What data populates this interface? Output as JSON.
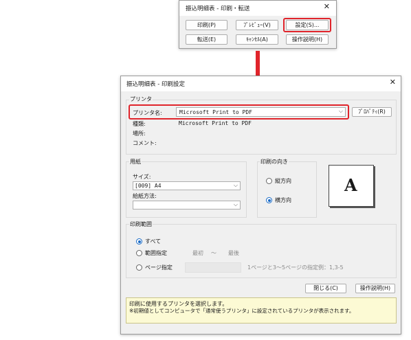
{
  "top_dialog": {
    "title": "振込明細表 - 印刷・転送",
    "buttons": {
      "print": "印刷(P)",
      "preview": "ﾌﾟﾚﾋﾞｭｰ(V)",
      "settings": "設定(S)...",
      "transfer": "転送(E)",
      "cancel": "ｷｬﾝｾﾙ(A)",
      "help": "操作説明(H)"
    }
  },
  "print_dialog": {
    "title": "振込明細表 - 印刷設定",
    "printer": {
      "group_label": "プリンタ",
      "name_label": "プリンタ名:",
      "name_value": "Microsoft Print to PDF",
      "properties_button": "ﾌﾟﾛﾊﾟﾃｨ(R)",
      "type_label": "種類:",
      "type_value": "Microsoft Print to PDF",
      "location_label": "場所:",
      "comment_label": "コメント:"
    },
    "paper": {
      "group_label": "用紙",
      "size_label": "サイズ:",
      "size_value": "[009] A4",
      "feed_label": "給紙方法:",
      "feed_value": ""
    },
    "orientation": {
      "group_label": "印刷の向き",
      "portrait": "縦方向",
      "landscape": "横方向",
      "selected": "landscape",
      "preview_letter": "A"
    },
    "range": {
      "group_label": "印刷範囲",
      "all": "すべて",
      "range_specify": "範囲指定",
      "from": "最初",
      "tilde": "～",
      "to": "最後",
      "page_specify": "ページ指定",
      "page_hint": "1ページと3～5ページの指定例：1,3-5",
      "selected": "all"
    },
    "buttons": {
      "close": "閉じる(C)",
      "help": "操作説明(H)"
    },
    "status_lines": [
      "印刷に使用するプリンタを選択します。",
      "※初期値としてコンピュータで「通常使うプリンタ」に設定されているプリンタが表示されます。"
    ]
  },
  "colors": {
    "highlight": "#e0242b",
    "arrow": "#e0242b",
    "radio_selected": "#1a6bc6",
    "status_bg": "#fcfad4"
  },
  "icons": [
    "close-icon",
    "chevron-down-icon",
    "arrow-down-icon"
  ]
}
